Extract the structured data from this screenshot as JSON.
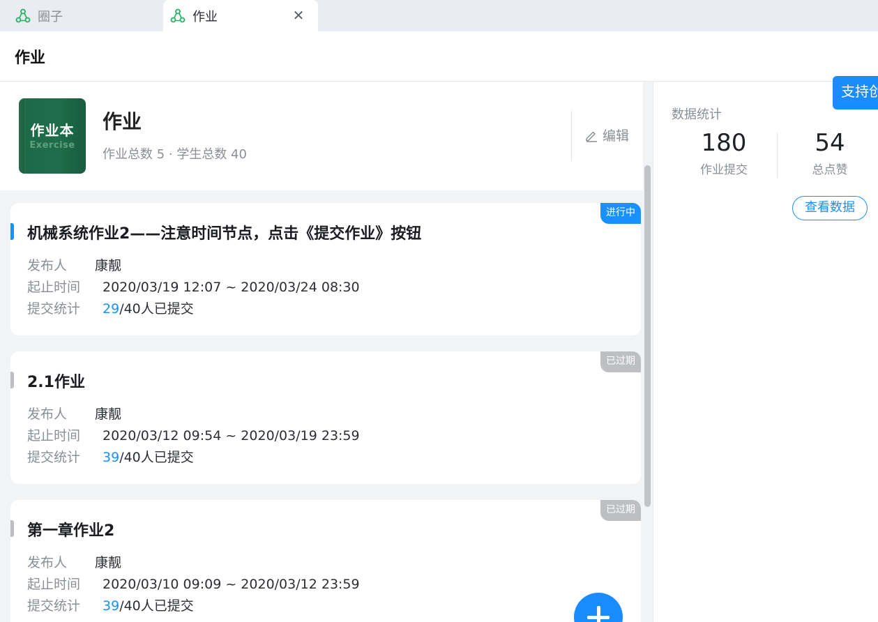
{
  "tabs": [
    {
      "label": "圈子",
      "active": false
    },
    {
      "label": "作业",
      "active": true
    }
  ],
  "header": {
    "title": "作业"
  },
  "course": {
    "cover_title": "作业本",
    "cover_subtitle": "Exercise",
    "title": "作业",
    "meta": "作业总数 5 · 学生总数 40",
    "edit_label": "编辑"
  },
  "assignments": [
    {
      "title": "机械系统作业2——注意时间节点，点击《提交作业》按钮",
      "status": "进行中",
      "status_color": "#1890ff",
      "publisher_label": "发布人",
      "publisher": "康靓",
      "time_label": "起止时间",
      "time": "2020/03/19 12:07 ~ 2020/03/24 08:30",
      "submit_label": "提交统计",
      "submitted": "29",
      "submit_suffix": "/40人已提交"
    },
    {
      "title": "2.1作业",
      "status": "已过期",
      "status_color": "#bdbfc3",
      "publisher_label": "发布人",
      "publisher": "康靓",
      "time_label": "起止时间",
      "time": "2020/03/12 09:54 ~ 2020/03/19 23:59",
      "submit_label": "提交统计",
      "submitted": "39",
      "submit_suffix": "/40人已提交"
    },
    {
      "title": "第一章作业2",
      "status": "已过期",
      "status_color": "#bdbfc3",
      "publisher_label": "发布人",
      "publisher": "康靓",
      "time_label": "起止时间",
      "time": "2020/03/10 09:09 ~ 2020/03/12 23:59",
      "submit_label": "提交统计",
      "submitted": "39",
      "submit_suffix": "/40人已提交"
    }
  ],
  "stats": {
    "label": "数据统计",
    "items": [
      {
        "value": "180",
        "label": "作业提交"
      },
      {
        "value": "54",
        "label": "总点赞"
      }
    ],
    "view_button": "查看数据"
  },
  "support_button": "支持创",
  "colors": {
    "accent": "#1890ff",
    "tab_icon": "#22b35e"
  }
}
